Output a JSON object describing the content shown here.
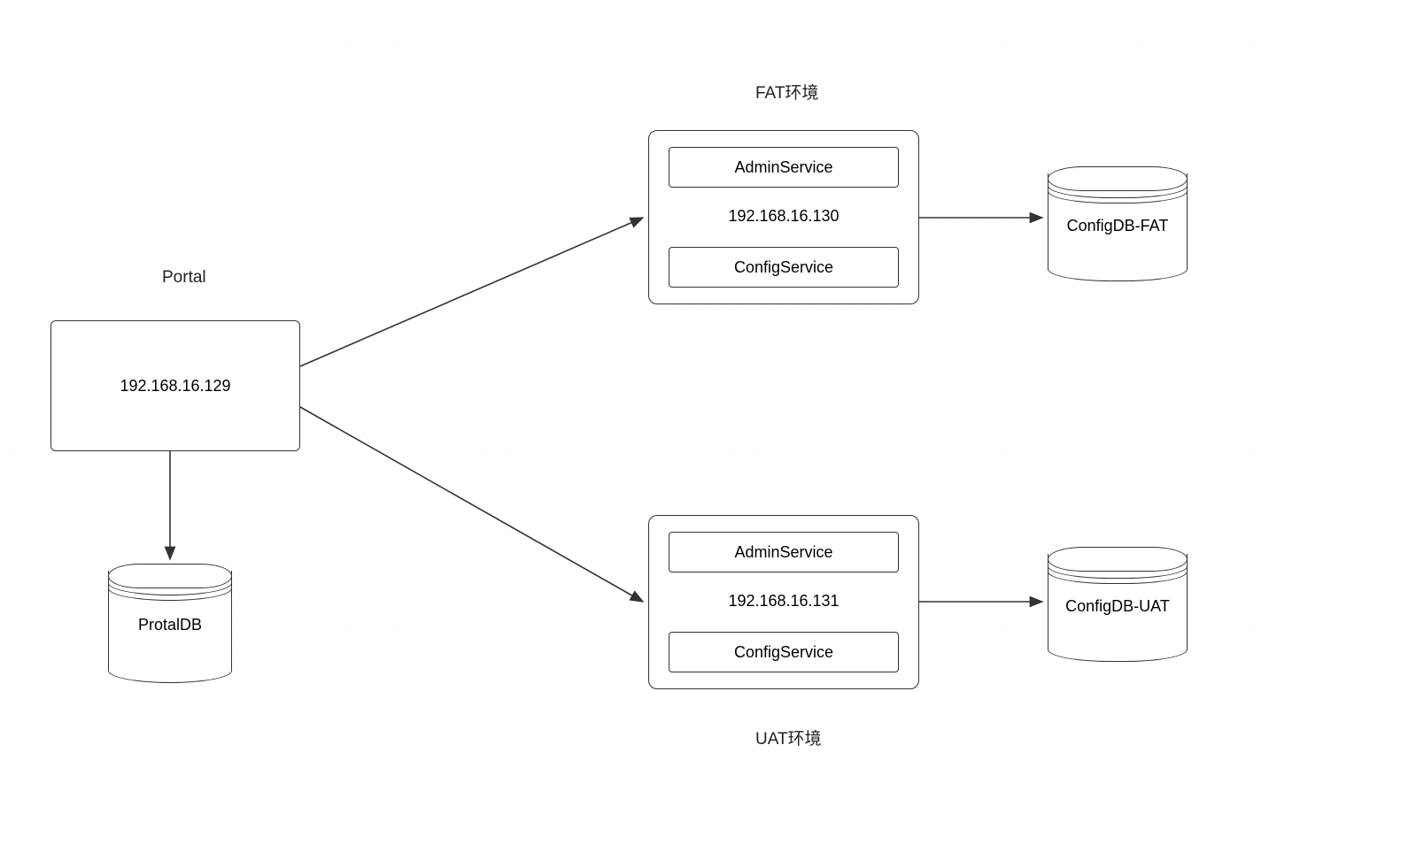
{
  "portal": {
    "title": "Portal",
    "ip": "192.168.16.129",
    "db": "ProtalDB"
  },
  "fat": {
    "title": "FAT环境",
    "admin": "AdminService",
    "config": "ConfigService",
    "ip": "192.168.16.130",
    "db": "ConfigDB-FAT"
  },
  "uat": {
    "title": "UAT环境",
    "admin": "AdminService",
    "config": "ConfigService",
    "ip": "192.168.16.131",
    "db": "ConfigDB-UAT"
  }
}
